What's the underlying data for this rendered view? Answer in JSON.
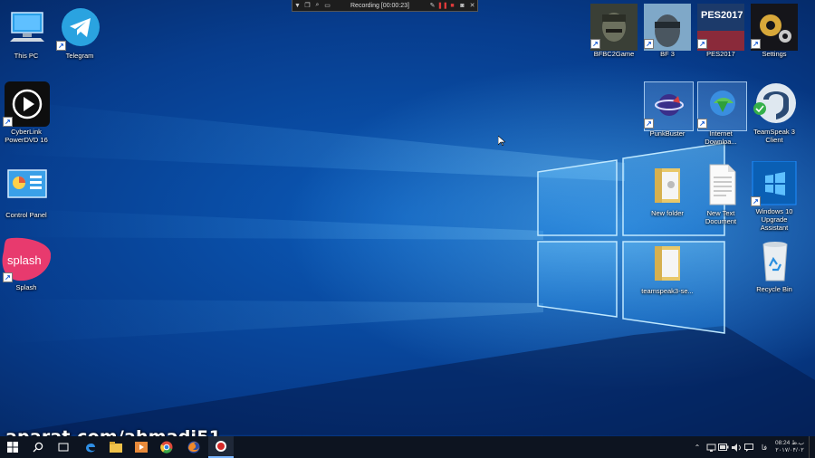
{
  "recording_bar": {
    "label": "Recording [00:00:23]"
  },
  "desktop_icons": {
    "this_pc": "This PC",
    "telegram": "Telegram",
    "cyberlink": "CyberLink PowerDVD 16",
    "control_panel": "Control Panel",
    "splash": "Splash",
    "splash_logo_text": "splash",
    "bfbc2": "BFBC2Game",
    "bf3": "BF 3",
    "pes2017": "PES2017",
    "pes_logo_text": "PES2017",
    "settings": "Settings",
    "punkbuster": "PunkBuster",
    "internet_download": "Internet Downloa...",
    "teamspeak": "TeamSpeak 3 Client",
    "new_folder": "New folder",
    "new_text_document": "New Text Document",
    "win10_assistant": "Windows 10 Upgrade Assistant",
    "teamspeak_setup_folder": "teamspeak3-se...",
    "recycle_bin": "Recycle Bin"
  },
  "watermark": "aparat.com/ahmadi51",
  "tray": {
    "time": "08:24",
    "ampm": "ب.ظ",
    "date": "۲۰۱۷/۰۴/۰۲",
    "language": "فا"
  },
  "colors": {
    "accent": "#0a74d9",
    "taskbar": "#0d1420"
  }
}
